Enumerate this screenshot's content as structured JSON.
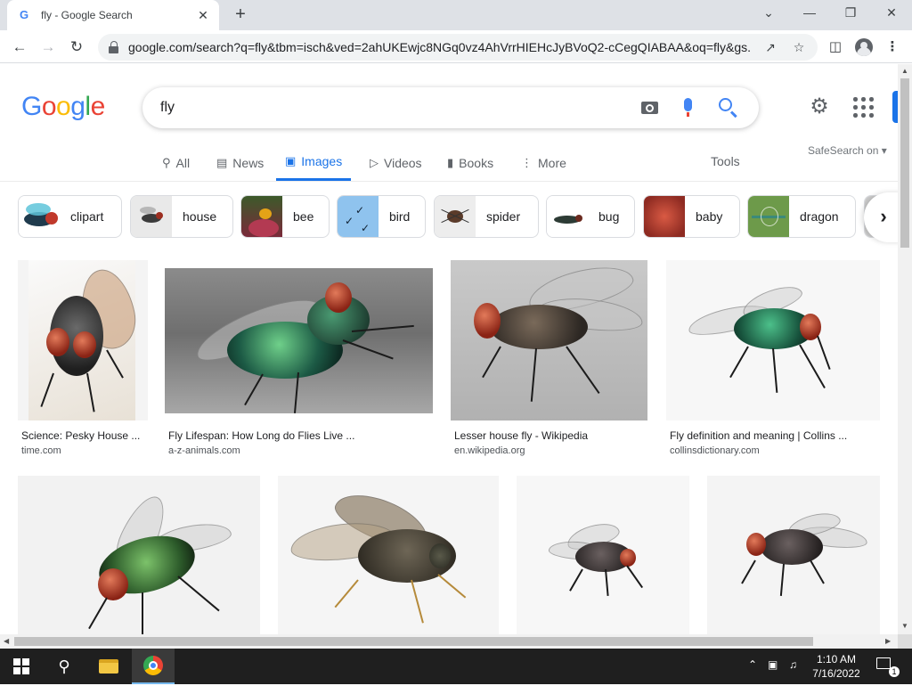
{
  "browser": {
    "tab_title": "fly - Google Search",
    "favicon": "G",
    "url": "google.com/search?q=fly&tbm=isch&ved=2ahUKEwjc8NGq0vz4AhVrrHIEHcJyBVoQ2-cCegQIABAA&oq=fly&gs...",
    "controls": {
      "minimize": "—",
      "restore": "❐",
      "close": "✕",
      "tab_list": "⌄",
      "new_tab": "+"
    }
  },
  "google": {
    "logo_letters": [
      "G",
      "o",
      "o",
      "g",
      "l",
      "e"
    ],
    "logo_colors": [
      "#4285f4",
      "#ea4335",
      "#fbbc05",
      "#4285f4",
      "#34a853",
      "#ea4335"
    ],
    "query": "fly",
    "tabs": [
      {
        "label": "All",
        "icon": "search-icon"
      },
      {
        "label": "News",
        "icon": "news-icon"
      },
      {
        "label": "Images",
        "icon": "images-icon"
      },
      {
        "label": "Videos",
        "icon": "videos-icon"
      },
      {
        "label": "Books",
        "icon": "books-icon"
      },
      {
        "label": "More",
        "icon": "more-dots-icon"
      }
    ],
    "active_tab": "Images",
    "tools_label": "Tools",
    "safesearch_label": "SafeSearch on ▾",
    "chips": [
      {
        "label": "clipart"
      },
      {
        "label": "house"
      },
      {
        "label": "bee"
      },
      {
        "label": "bird"
      },
      {
        "label": "spider"
      },
      {
        "label": "bug"
      },
      {
        "label": "baby"
      },
      {
        "label": "dragon"
      }
    ],
    "results": [
      {
        "title": "Science: Pesky House ...",
        "source": "time.com"
      },
      {
        "title": "Fly Lifespan: How Long do Flies Live ...",
        "source": "a-z-animals.com"
      },
      {
        "title": "Lesser house fly - Wikipedia",
        "source": "en.wikipedia.org"
      },
      {
        "title": "Fly definition and meaning | Collins ...",
        "source": "collinsdictionary.com"
      }
    ],
    "accent_color": "#1a73e8"
  },
  "taskbar": {
    "time": "1:10 AM",
    "date": "7/16/2022",
    "notification_count": "1"
  }
}
